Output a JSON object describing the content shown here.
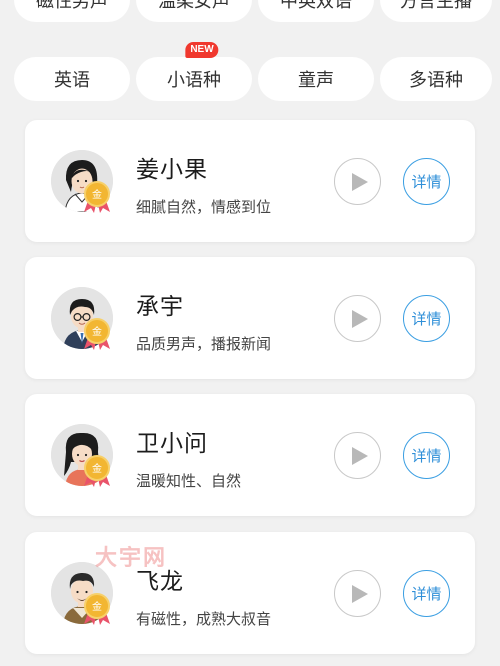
{
  "chips_row1": [
    {
      "label": "磁性男声"
    },
    {
      "label": "温柔女声"
    },
    {
      "label": "中英双语"
    },
    {
      "label": "方言主播"
    }
  ],
  "chips_row2": [
    {
      "label": "英语"
    },
    {
      "label": "小语种",
      "badge": "NEW"
    },
    {
      "label": "童声"
    },
    {
      "label": "多语种"
    }
  ],
  "voices": [
    {
      "name": "姜小果",
      "desc": "细腻自然，情感到位",
      "detail_label": "详情",
      "medal_label": "金"
    },
    {
      "name": "承宇",
      "desc": "品质男声，播报新闻",
      "detail_label": "详情",
      "medal_label": "金"
    },
    {
      "name": "卫小问",
      "desc": "温暖知性、自然",
      "detail_label": "详情",
      "medal_label": "金"
    },
    {
      "name": "飞龙",
      "desc": "有磁性，成熟大叔音",
      "detail_label": "详情",
      "medal_label": "金"
    }
  ],
  "watermark": "大宇网",
  "colors": {
    "accent": "#3a9ee2",
    "badge": "#f0382e",
    "medal_gold": "#f2b632",
    "medal_ribbon": "#e9536a",
    "background": "#f1f1f1"
  }
}
